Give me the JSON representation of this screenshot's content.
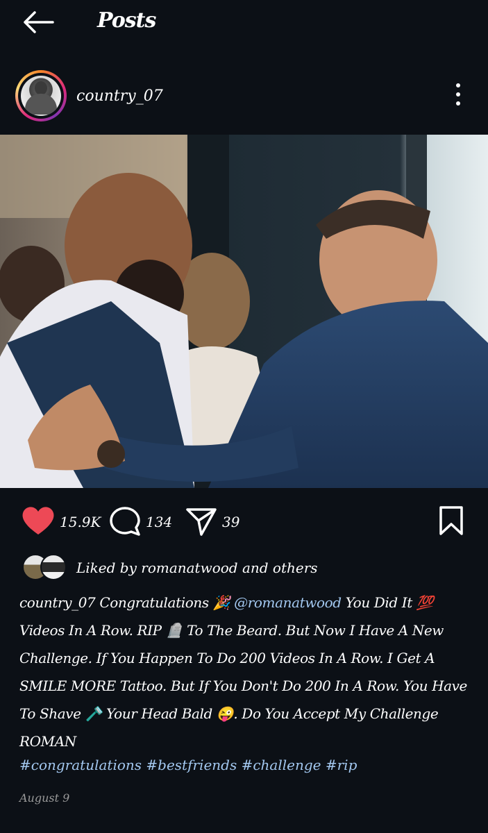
{
  "header": {
    "title": "Posts",
    "back_icon": "arrow-left-icon"
  },
  "post": {
    "username": "country_07",
    "more_icon": "more-vertical-icon",
    "likes": {
      "count": "15.9K",
      "liked_by": "Liked by romanatwood and others",
      "heart_color": "#ed4956"
    },
    "comments": {
      "count": "134"
    },
    "shares": {
      "count": "39"
    },
    "caption": {
      "username": "country_07",
      "text_1": " Congratulations 🎉 ",
      "mention": "@romanatwood",
      "text_2": " You Did It 💯 Videos In A Row. RIP 🪦 To The Beard.  But Now I Have A New Challenge. If You Happen To Do 200 Videos In A Row. I Get A SMILE MORE Tattoo. But If You Don't Do 200 In A Row. You Have To Shave 🪒 Your Head Bald 😜. Do You Accept My Challenge ROMAN",
      "dot": ".",
      "hashtags": "#congratulations #bestfriends #challenge #rip"
    },
    "date": "August 9"
  },
  "colors": {
    "background": "#0c1016",
    "link": "#a3c8f0",
    "muted": "#9a9a9a"
  }
}
